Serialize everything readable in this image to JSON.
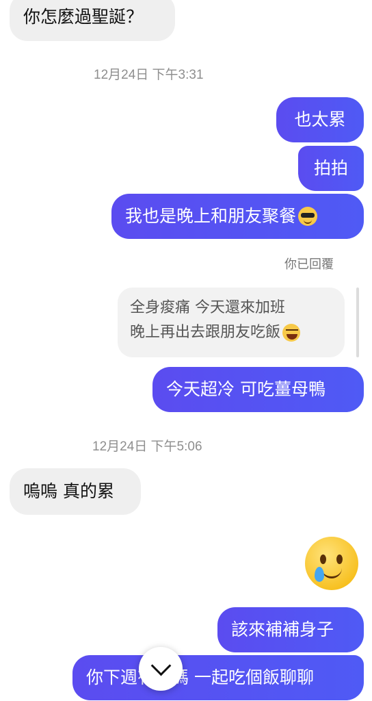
{
  "messages": {
    "m1": "你怎麼過聖誕？",
    "t1": "12月24日 下午3:31",
    "m2": "也太累",
    "m3": "拍拍",
    "m4": "我也是晚上和朋友聚餐",
    "reply_label": "你已回覆",
    "quote_line1": "全身痠痛 今天還來加班",
    "quote_line2": "晚上再出去跟朋友吃飯",
    "m5": "今天超冷 可吃薑母鴨",
    "t2": "12月24日 下午5:06",
    "m6": "嗚嗚 真的累",
    "m7": "該來補補身子",
    "m8": "你下週有空嗎 一起吃個飯聊聊"
  },
  "icons": {
    "m4_emoji": "smiling-face-with-sunglasses",
    "quote_emoji": "grinning-squinting-face",
    "big_emoji": "face-holding-back-tears",
    "scroll_button": "chevron-down"
  },
  "colors": {
    "outgoing_bubble": "#5352f2",
    "incoming_bubble": "#efefef",
    "timestamp": "#8e8e8e"
  }
}
